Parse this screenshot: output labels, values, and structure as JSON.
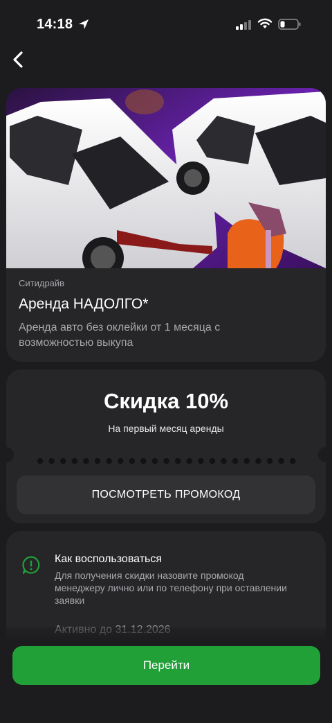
{
  "status_bar": {
    "time": "14:18"
  },
  "offer": {
    "brand": "Ситидрайв",
    "title": "Аренда НАДОЛГО*",
    "description": "Аренда авто без оклейки от 1 месяца с возможностью выкупа"
  },
  "discount": {
    "headline": "Скидка 10%",
    "subtitle": "На первый месяц аренды",
    "promo_button": "ПОСМОТРЕТЬ ПРОМОКОД"
  },
  "how_to": {
    "title": "Как воспользоваться",
    "text": "Для получения скидки назовите промокод менеджеру лично или по телефону при оставлении заявки",
    "valid_until": "Активно до 31.12.2026"
  },
  "cta": {
    "label": "Перейти"
  },
  "colors": {
    "background": "#1c1c1e",
    "card": "#262628",
    "accent": "#21a038",
    "muted": "#a8a8ad"
  },
  "icons": [
    "location-arrow-icon",
    "signal-icon",
    "wifi-icon",
    "battery-icon",
    "back-chevron-icon",
    "info-icon"
  ]
}
